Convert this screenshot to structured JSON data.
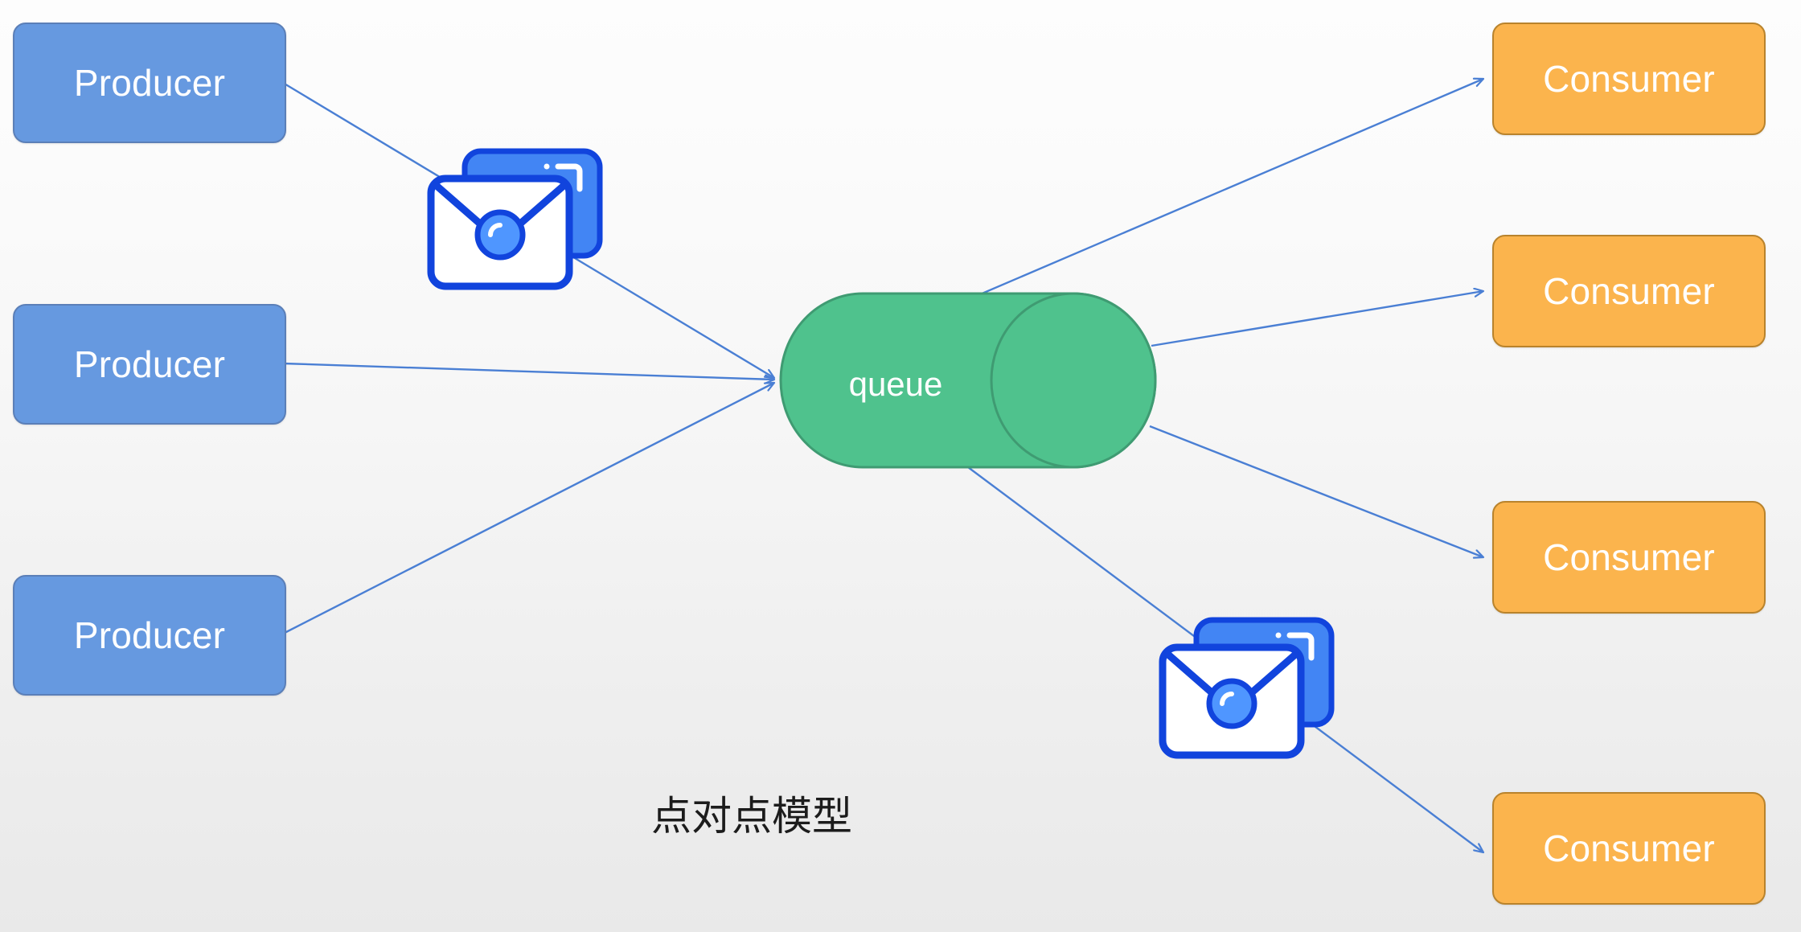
{
  "diagram": {
    "caption": "点对点模型",
    "background_top_color": "#fdfdfd",
    "background_bottom_color": "#e9e9e9",
    "line_color": "#4a7fd4"
  },
  "producers": [
    {
      "label": "Producer",
      "fill": "#6699e0",
      "stroke": "#5b7fb8"
    },
    {
      "label": "Producer",
      "fill": "#6699e0",
      "stroke": "#5b7fb8"
    },
    {
      "label": "Producer",
      "fill": "#6699e0",
      "stroke": "#5b7fb8"
    }
  ],
  "queue": {
    "label": "queue",
    "fill": "#4fc28d",
    "stroke": "#3f9b72"
  },
  "consumers": [
    {
      "label": "Consumer",
      "fill": "#fbb44d",
      "stroke": "#b9832c"
    },
    {
      "label": "Consumer",
      "fill": "#fbb44d",
      "stroke": "#b9832c"
    },
    {
      "label": "Consumer",
      "fill": "#fbb44d",
      "stroke": "#b9832c"
    },
    {
      "label": "Consumer",
      "fill": "#fbb44d",
      "stroke": "#b9832c"
    }
  ],
  "message_icons": [
    {
      "name": "message-envelope-inbound",
      "card_fill": "#4285f4",
      "outline": "#1144dd",
      "front_fill": "#ffffff"
    },
    {
      "name": "message-envelope-outbound",
      "card_fill": "#4285f4",
      "outline": "#1144dd",
      "front_fill": "#ffffff"
    }
  ]
}
